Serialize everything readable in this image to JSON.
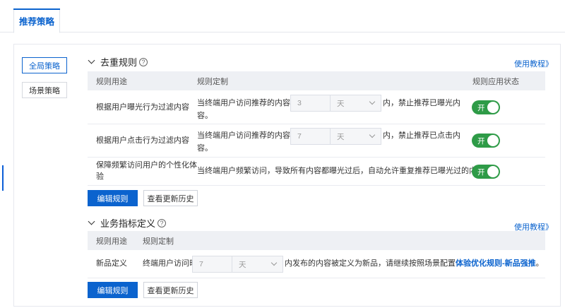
{
  "tabs": {
    "active_label": "推荐策略"
  },
  "sidebar": {
    "items": [
      {
        "label": "全局策略"
      },
      {
        "label": "场景策略"
      }
    ]
  },
  "dedup": {
    "title": "去重规则",
    "help_link": "使用教程》",
    "columns": {
      "purpose": "规则用途",
      "custom": "规则定制",
      "status": "规则应用状态"
    },
    "rows": [
      {
        "purpose": "根据用户曝光行为过滤内容",
        "text_before": "当终端用户访问推荐的内容流时,",
        "value": "3",
        "unit": "天",
        "text_after": "内，禁止推荐已曝光内",
        "text_wrap": "容。",
        "toggle": "开"
      },
      {
        "purpose": "根据用户点击行为过滤内容",
        "text_before": "当终端用户访问推荐的内容流时,",
        "value": "7",
        "unit": "天",
        "text_after": "内，禁止推荐已点击内",
        "text_wrap": "容。",
        "toggle": "开"
      },
      {
        "purpose_line1": "保障频繁访问用户的个性化体",
        "purpose_line2": "验",
        "text": "当终端用户频繁访问，导致所有内容都曝光过后，自动允许重复推荐已曝光过的内容",
        "toggle": "开"
      }
    ],
    "edit_button": "编辑规则",
    "history_button": "查看更新历史"
  },
  "metrics": {
    "title": "业务指标定义",
    "help_link": "使用教程》",
    "columns": {
      "purpose": "规则用途",
      "custom": "规则定制"
    },
    "row": {
      "purpose": "新品定义",
      "text_before": "终端用户访问时,",
      "value": "7",
      "unit": "天",
      "text_after": "内发布的内容被定义为新品，请继续按照场景配置",
      "link": "体验优化规则-新品强推",
      "text_end": "。"
    },
    "edit_button": "编辑规则",
    "history_button": "查看更新历史"
  },
  "colors": {
    "accent": "#0b63ce",
    "toggle_on": "#2e9b47",
    "header_bg": "#eef0f4"
  }
}
